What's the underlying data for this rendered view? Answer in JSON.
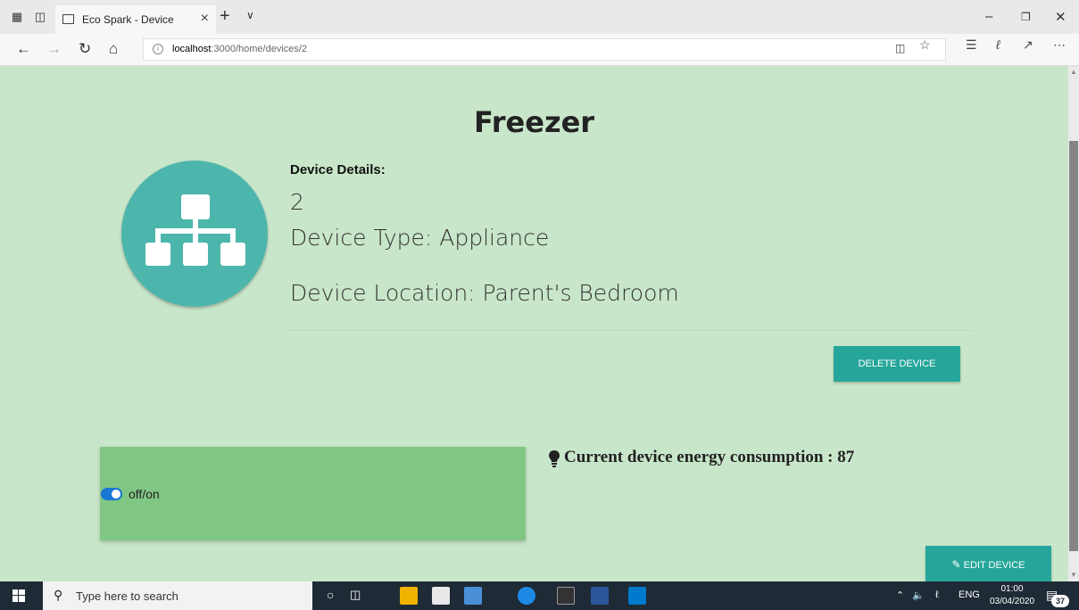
{
  "browser": {
    "tab_title": "Eco Spark - Device",
    "url_host": "localhost",
    "url_path": ":3000/home/devices/2"
  },
  "page": {
    "title": "Freezer",
    "details_heading": "Device Details:",
    "device_id": "2",
    "device_type": "Device Type: Appliance",
    "device_location": "Device Location: Parent's Bedroom",
    "delete_button": "DELETE DEVICE",
    "toggle_label": "off/on",
    "toggle_state": "on",
    "energy_text": "Current device energy consumption : 87",
    "edit_button": "EDIT DEVICE"
  },
  "taskbar": {
    "search_placeholder": "Type here to search",
    "language": "ENG",
    "time": "01:00",
    "date": "03/04/2020",
    "notification_count": "37"
  },
  "colors": {
    "page_bg": "#c8e6c9",
    "accent_teal": "#26a69a",
    "device_circle": "#4db6ac",
    "toggle_card": "#81c784",
    "toggle_on": "#1976d2"
  }
}
